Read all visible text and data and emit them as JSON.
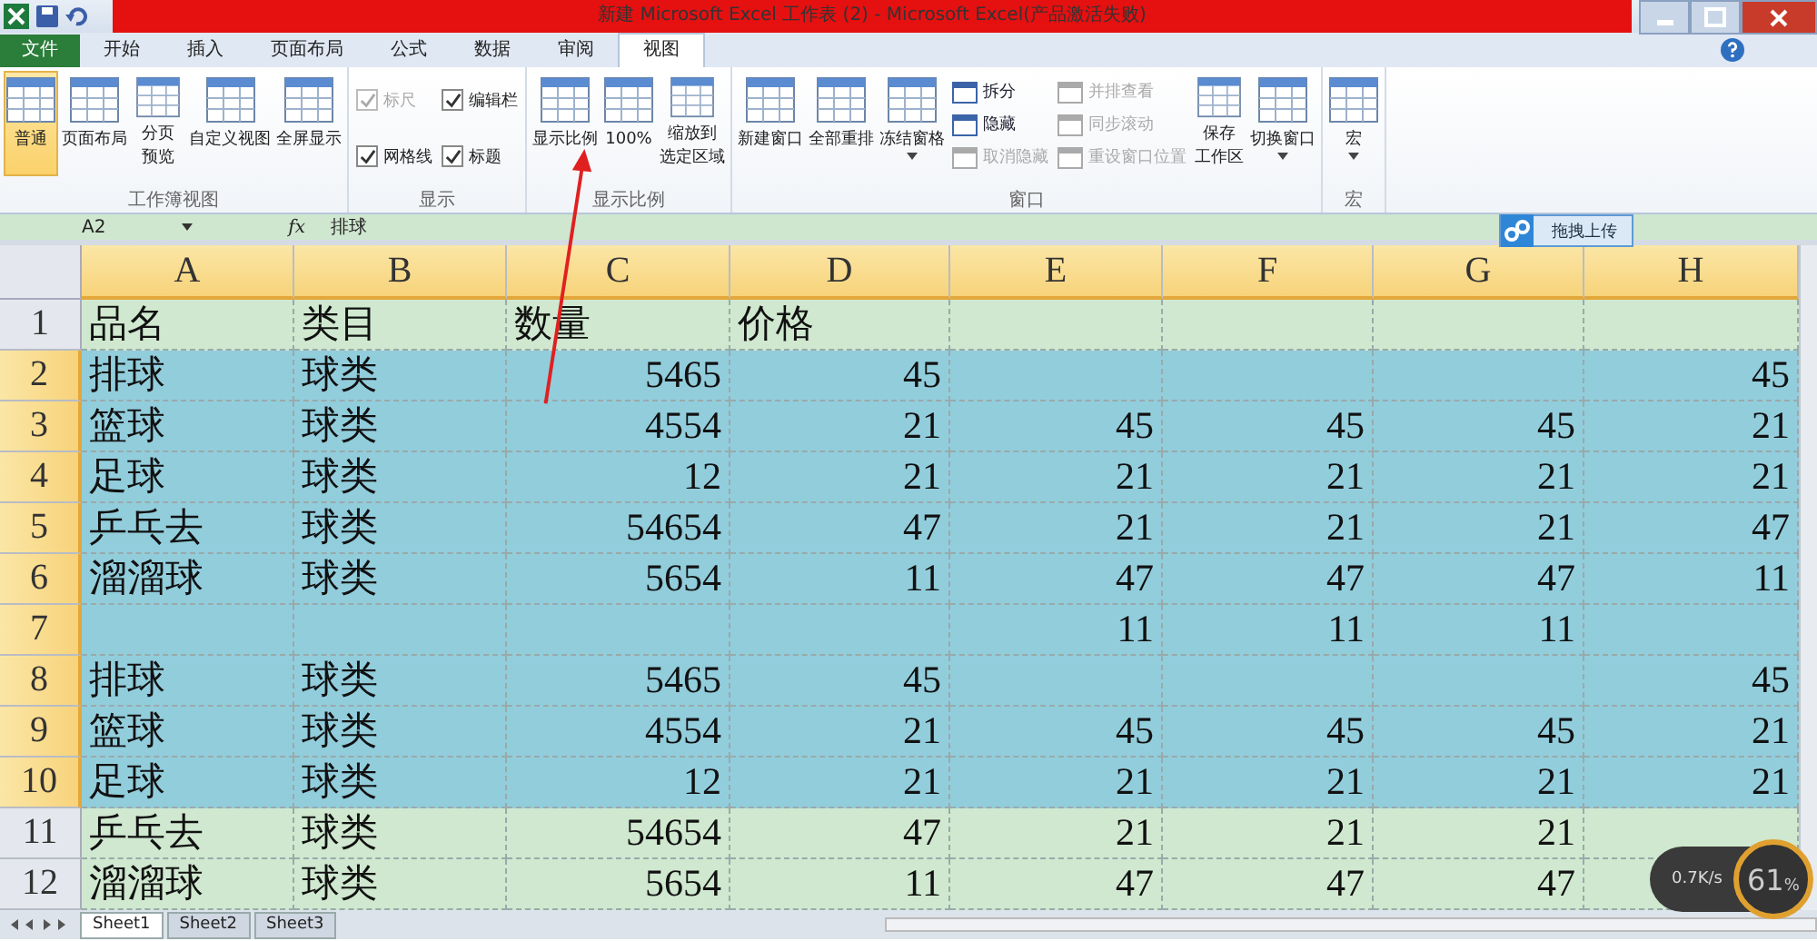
{
  "window": {
    "title": "新建 Microsoft Excel 工作表 (2)  -  Microsoft Excel(产品激活失败)"
  },
  "tabs": [
    {
      "label": "文件",
      "kind": "file",
      "selected": false
    },
    {
      "label": "开始",
      "kind": "tab",
      "selected": false
    },
    {
      "label": "插入",
      "kind": "tab",
      "selected": false
    },
    {
      "label": "页面布局",
      "kind": "tab",
      "selected": false
    },
    {
      "label": "公式",
      "kind": "tab",
      "selected": false
    },
    {
      "label": "数据",
      "kind": "tab",
      "selected": false
    },
    {
      "label": "审阅",
      "kind": "tab",
      "selected": false
    },
    {
      "label": "视图",
      "kind": "tab",
      "selected": true
    }
  ],
  "ribbon": [
    {
      "label": "工作簿视图",
      "columns": [
        [
          {
            "kind": "large",
            "label": "普通",
            "selected": true
          }
        ],
        [
          {
            "kind": "large",
            "label": "页面布局",
            "selected": false
          }
        ],
        [
          {
            "kind": "large",
            "label": [
              "分页",
              "预览"
            ],
            "selected": false
          }
        ],
        [
          {
            "kind": "large",
            "label": "自定义视图",
            "selected": false
          }
        ],
        [
          {
            "kind": "large",
            "label": "全屏显示",
            "selected": false
          }
        ]
      ]
    },
    {
      "label": "显示",
      "columns": [
        [
          {
            "kind": "check",
            "label": "标尺",
            "checked": true,
            "disabled": true
          },
          {
            "kind": "check",
            "label": "网格线",
            "checked": true,
            "disabled": false
          }
        ],
        [
          {
            "kind": "check",
            "label": "编辑栏",
            "checked": true,
            "disabled": false
          },
          {
            "kind": "check",
            "label": "标题",
            "checked": true,
            "disabled": false
          }
        ]
      ]
    },
    {
      "label": "显示比例",
      "columns": [
        [
          {
            "kind": "large",
            "label": "显示比例",
            "selected": false
          }
        ],
        [
          {
            "kind": "large",
            "label": "100%",
            "selected": false
          }
        ],
        [
          {
            "kind": "large",
            "label": [
              "缩放到",
              "选定区域"
            ],
            "selected": false
          }
        ]
      ]
    },
    {
      "label": "窗口",
      "columns": [
        [
          {
            "kind": "large",
            "label": "新建窗口",
            "selected": false
          }
        ],
        [
          {
            "kind": "large",
            "label": "全部重排",
            "selected": false
          }
        ],
        [
          {
            "kind": "large",
            "label": "冻结窗格",
            "selected": false,
            "menu": true
          }
        ],
        [
          {
            "kind": "small",
            "label": "拆分",
            "disabled": false
          },
          {
            "kind": "small",
            "label": "隐藏",
            "disabled": false
          },
          {
            "kind": "small",
            "label": "取消隐藏",
            "disabled": true
          }
        ],
        [
          {
            "kind": "small",
            "label": "并排查看",
            "disabled": true
          },
          {
            "kind": "small",
            "label": "同步滚动",
            "disabled": true
          },
          {
            "kind": "small",
            "label": "重设窗口位置",
            "disabled": true
          }
        ],
        [
          {
            "kind": "large",
            "label": [
              "保存",
              "工作区"
            ],
            "selected": false
          }
        ],
        [
          {
            "kind": "large",
            "label": "切换窗口",
            "selected": false,
            "menu": true
          }
        ]
      ]
    },
    {
      "label": "宏",
      "columns": [
        [
          {
            "kind": "large",
            "label": "宏",
            "selected": false,
            "menu": true
          }
        ]
      ]
    }
  ],
  "formula_bar": {
    "name_box": "A2",
    "fx": "fx",
    "value": "排球"
  },
  "upload_button": "拖拽上传",
  "columns": [
    {
      "label": "A",
      "selected": true
    },
    {
      "label": "B",
      "selected": true
    },
    {
      "label": "C",
      "selected": true
    },
    {
      "label": "D",
      "selected": true
    },
    {
      "label": "E",
      "selected": true
    },
    {
      "label": "F",
      "selected": true
    },
    {
      "label": "G",
      "selected": true
    },
    {
      "label": "H",
      "selected": true
    }
  ],
  "rows": [
    {
      "number": "1",
      "selected": false,
      "cells": [
        "品名",
        "类目",
        "数量",
        "价格",
        "",
        "",
        "",
        ""
      ]
    },
    {
      "number": "2",
      "selected": true,
      "cells": [
        "排球",
        "球类",
        "5465",
        "45",
        "",
        "",
        "",
        "45"
      ]
    },
    {
      "number": "3",
      "selected": true,
      "cells": [
        "篮球",
        "球类",
        "4554",
        "21",
        "45",
        "45",
        "45",
        "21"
      ]
    },
    {
      "number": "4",
      "selected": true,
      "cells": [
        "足球",
        "球类",
        "12",
        "21",
        "21",
        "21",
        "21",
        "21"
      ]
    },
    {
      "number": "5",
      "selected": true,
      "cells": [
        "乒乓去",
        "球类",
        "54654",
        "47",
        "21",
        "21",
        "21",
        "47"
      ]
    },
    {
      "number": "6",
      "selected": true,
      "cells": [
        "溜溜球",
        "球类",
        "5654",
        "11",
        "47",
        "47",
        "47",
        "11"
      ]
    },
    {
      "number": "7",
      "selected": true,
      "cells": [
        "",
        "",
        "",
        "",
        "11",
        "11",
        "11",
        ""
      ]
    },
    {
      "number": "8",
      "selected": true,
      "cells": [
        "排球",
        "球类",
        "5465",
        "45",
        "",
        "",
        "",
        "45"
      ]
    },
    {
      "number": "9",
      "selected": true,
      "cells": [
        "篮球",
        "球类",
        "4554",
        "21",
        "45",
        "45",
        "45",
        "21"
      ]
    },
    {
      "number": "10",
      "selected": true,
      "cells": [
        "足球",
        "球类",
        "12",
        "21",
        "21",
        "21",
        "21",
        "21"
      ]
    },
    {
      "number": "11",
      "selected": false,
      "cells": [
        "乒乓去",
        "球类",
        "54654",
        "47",
        "21",
        "21",
        "21",
        ""
      ]
    },
    {
      "number": "12",
      "selected": false,
      "cells": [
        "溜溜球",
        "球类",
        "5654",
        "11",
        "47",
        "47",
        "47",
        ""
      ]
    }
  ],
  "sheets": [
    {
      "label": "Sheet1",
      "selected": true
    },
    {
      "label": "Sheet2",
      "selected": false
    },
    {
      "label": "Sheet3",
      "selected": false
    }
  ],
  "speed_widget": {
    "rate": "0.7K/s",
    "percent": "61",
    "unit": "%"
  }
}
